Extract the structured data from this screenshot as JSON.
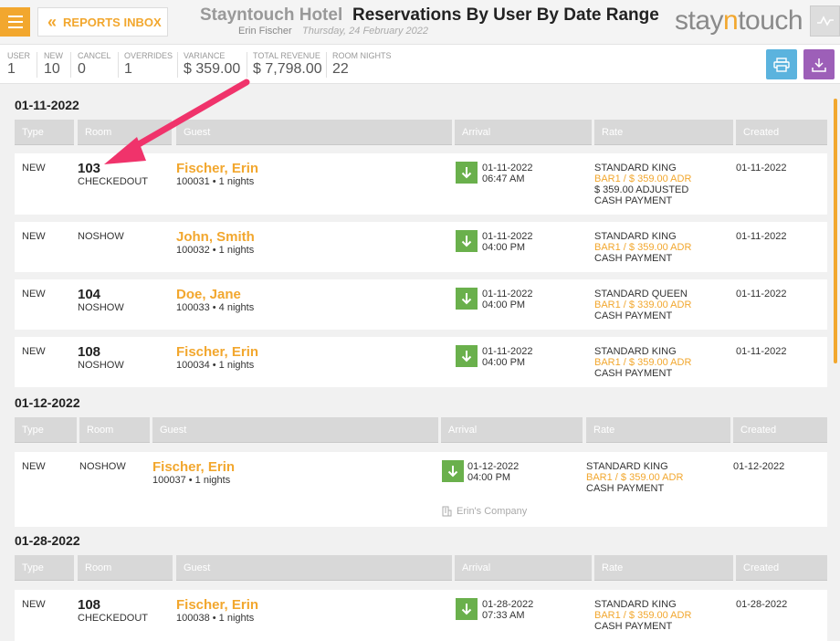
{
  "header": {
    "inbox_label": "REPORTS INBOX",
    "hotel_name": "Stayntouch Hotel",
    "report_title": "Reservations By User By Date Range",
    "user_name": "Erin Fischer",
    "report_date": "Thursday, 24 February 2022",
    "logo_pre": "stay",
    "logo_mid": "n",
    "logo_post": "touch"
  },
  "summary": [
    {
      "key": "USER",
      "value": "1"
    },
    {
      "key": "NEW",
      "value": "10"
    },
    {
      "key": "CANCEL",
      "value": "0"
    },
    {
      "key": "OVERRIDES",
      "value": "1"
    },
    {
      "key": "VARIANCE",
      "value": "$ 359.00"
    },
    {
      "key": "TOTAL REVENUE",
      "value": "$ 7,798.00"
    },
    {
      "key": "ROOM NIGHTS",
      "value": "22"
    }
  ],
  "columns": [
    "Type",
    "Room",
    "Guest",
    "Arrival",
    "Rate",
    "Created"
  ],
  "groups": [
    {
      "date": "01-11-2022",
      "rows": [
        {
          "type": "NEW",
          "room": "103",
          "room_status": "CHECKEDOUT",
          "guest": "Fischer, Erin",
          "conf": "100031 • 1 nights",
          "arr_date": "01-11-2022",
          "arr_time": "06:47 AM",
          "rate": "STANDARD KING",
          "rate_adr": "BAR1 / $ 359.00 ADR",
          "rate_extra": "$ 359.00 ADJUSTED",
          "payment": "CASH PAYMENT",
          "created": "01-11-2022"
        },
        {
          "type": "NEW",
          "room": "",
          "room_status": "NOSHOW",
          "guest": "John, Smith",
          "conf": "100032 • 1 nights",
          "arr_date": "01-11-2022",
          "arr_time": "04:00 PM",
          "rate": "STANDARD KING",
          "rate_adr": "BAR1 / $ 359.00 ADR",
          "rate_extra": "",
          "payment": "CASH PAYMENT",
          "created": "01-11-2022"
        },
        {
          "type": "NEW",
          "room": "104",
          "room_status": "NOSHOW",
          "guest": "Doe, Jane",
          "conf": "100033 • 4 nights",
          "arr_date": "01-11-2022",
          "arr_time": "04:00 PM",
          "rate": "STANDARD QUEEN",
          "rate_adr": "BAR1 / $ 339.00 ADR",
          "rate_extra": "",
          "payment": "CASH PAYMENT",
          "created": "01-11-2022"
        },
        {
          "type": "NEW",
          "room": "108",
          "room_status": "NOSHOW",
          "guest": "Fischer, Erin",
          "conf": "100034 • 1 nights",
          "arr_date": "01-11-2022",
          "arr_time": "04:00 PM",
          "rate": "STANDARD KING",
          "rate_adr": "BAR1 / $ 359.00 ADR",
          "rate_extra": "",
          "payment": "CASH PAYMENT",
          "created": "01-11-2022"
        }
      ]
    },
    {
      "date": "01-12-2022",
      "rows": [
        {
          "type": "NEW",
          "room": "",
          "room_status": "NOSHOW",
          "guest": "Fischer, Erin",
          "conf": "100037 • 1 nights",
          "arr_date": "01-12-2022",
          "arr_time": "04:00 PM",
          "rate": "STANDARD KING",
          "rate_adr": "BAR1 / $ 359.00 ADR",
          "rate_extra": "",
          "payment": "CASH PAYMENT",
          "created": "01-12-2022",
          "company": "Erin's Company"
        }
      ]
    },
    {
      "date": "01-28-2022",
      "rows": [
        {
          "type": "NEW",
          "room": "108",
          "room_status": "CHECKEDOUT",
          "guest": "Fischer, Erin",
          "conf": "100038 • 1 nights",
          "arr_date": "01-28-2022",
          "arr_time": "07:33 AM",
          "rate": "STANDARD KING",
          "rate_adr": "BAR1 / $ 359.00 ADR",
          "rate_extra": "",
          "payment": "CASH PAYMENT",
          "created": "01-28-2022"
        }
      ]
    }
  ],
  "colors": {
    "accent": "#f2a72e",
    "arrival_green": "#6ab04c",
    "annotation_arrow": "#f0336b"
  }
}
